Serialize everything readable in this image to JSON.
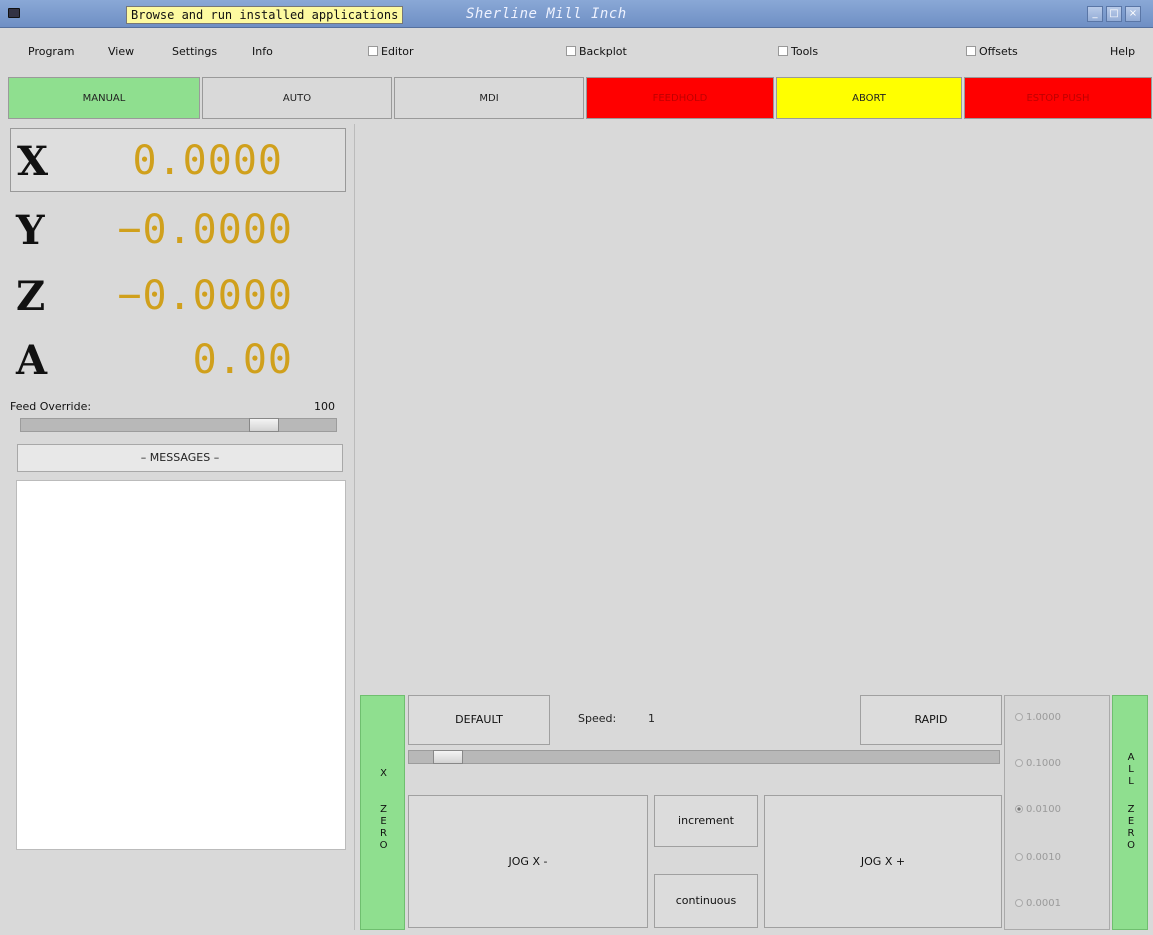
{
  "window": {
    "title": "Sherline Mill Inch",
    "tooltip": "Browse and run installed applications"
  },
  "menu": {
    "items": [
      "Program",
      "View",
      "Settings",
      "Info"
    ],
    "checkboxes": [
      "Editor",
      "Backplot",
      "Tools",
      "Offsets"
    ],
    "help": "Help"
  },
  "modes": {
    "manual": "MANUAL",
    "auto": "AUTO",
    "mdi": "MDI",
    "feedhold": "FEEDHOLD",
    "abort": "ABORT",
    "estop": "ESTOP PUSH"
  },
  "colors": {
    "manual": "#8fdf8f",
    "feedhold": "#ff0000",
    "abort": "#ffff00",
    "estop": "#ff0000",
    "dro_value": "#d0a01c"
  },
  "dro": [
    {
      "axis": "X",
      "value": "0.0000"
    },
    {
      "axis": "Y",
      "value": "−0.0000"
    },
    {
      "axis": "Z",
      "value": "−0.0000"
    },
    {
      "axis": "A",
      "value": "0.00"
    }
  ],
  "feed_override": {
    "label": "Feed Override:",
    "value": "100",
    "level": 0.8
  },
  "messages": {
    "button": "– MESSAGES –"
  },
  "jog": {
    "x_zero": [
      "X",
      "",
      "Z",
      "E",
      "R",
      "O"
    ],
    "all_zero": [
      "A",
      "L",
      "L",
      "",
      "Z",
      "E",
      "R",
      "O"
    ],
    "default": "DEFAULT",
    "speed_label": "Speed:",
    "speed_value": "1",
    "rapid": "RAPID",
    "jog_minus": "JOG X -",
    "jog_plus": "JOG X +",
    "increment": "increment",
    "continuous": "continuous",
    "speed_level": 0.05
  },
  "increments": [
    {
      "label": "1.0000",
      "selected": false
    },
    {
      "label": "0.1000",
      "selected": false
    },
    {
      "label": "0.0100",
      "selected": true
    },
    {
      "label": "0.0010",
      "selected": false
    },
    {
      "label": "0.0001",
      "selected": false
    }
  ]
}
